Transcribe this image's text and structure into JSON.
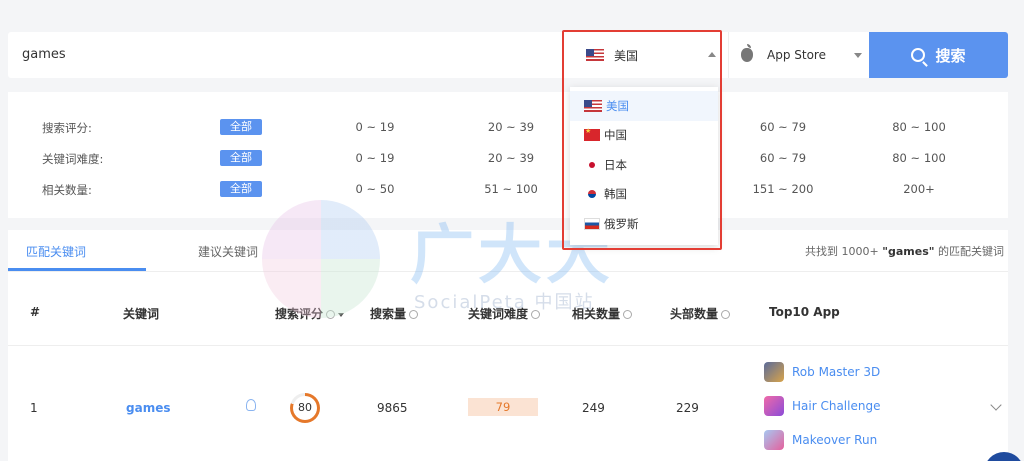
{
  "search": {
    "query": "games",
    "country_selected": "美国",
    "store_selected": "App Store",
    "button_label": "搜索"
  },
  "country_dropdown": {
    "options": [
      {
        "label": "美国",
        "flag": "flag-us",
        "active": true
      },
      {
        "label": "中国",
        "flag": "flag-cn"
      },
      {
        "label": "日本",
        "flag": "flag-jp"
      },
      {
        "label": "韩国",
        "flag": "flag-kr"
      },
      {
        "label": "俄罗斯",
        "flag": "flag-ru"
      }
    ]
  },
  "filters": {
    "all_label": "全部",
    "rows": [
      {
        "label": "搜索评分:",
        "options": [
          "0 ~ 19",
          "20 ~ 39",
          "",
          "60 ~ 79",
          "80 ~ 100"
        ]
      },
      {
        "label": "关键词难度:",
        "options": [
          "0 ~ 19",
          "20 ~ 39",
          "",
          "60 ~ 79",
          "80 ~ 100"
        ]
      },
      {
        "label": "相关数量:",
        "options": [
          "0 ~ 50",
          "51 ~ 100",
          "",
          "151 ~ 200",
          "200+"
        ]
      }
    ]
  },
  "tabs": {
    "match": "匹配关键词",
    "suggest": "建议关键词",
    "result_prefix": "共找到 1000+ ",
    "result_keyword": "\"games\"",
    "result_suffix": " 的匹配关键词"
  },
  "table": {
    "headers": {
      "index": "#",
      "keyword": "关键词",
      "score": "搜索评分",
      "volume": "搜索量",
      "difficulty": "关键词难度",
      "related": "相关数量",
      "top": "头部数量",
      "top10": "Top10 App"
    },
    "rows": [
      {
        "index": "1",
        "keyword": "games",
        "score": "80",
        "volume": "9865",
        "difficulty": "79",
        "related": "249",
        "top": "229",
        "apps": [
          "Rob Master 3D",
          "Hair Challenge",
          "Makeover Run"
        ]
      }
    ]
  },
  "watermark": {
    "title": "广大大",
    "subtitle": "SocialPeta 中国站"
  },
  "colors": {
    "accent": "#5b93ef",
    "link": "#4a8df0",
    "highlight_border": "#e33d34",
    "score_ring": "#e5782a"
  }
}
